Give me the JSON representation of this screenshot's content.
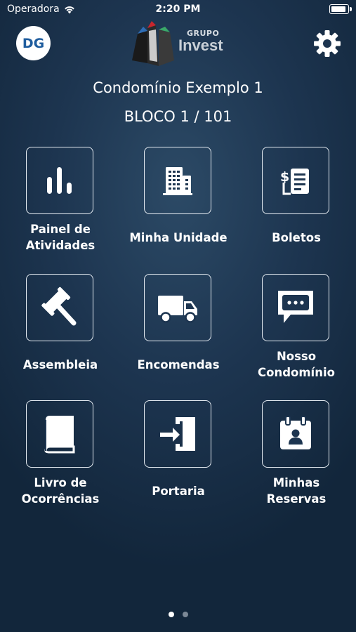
{
  "status_bar": {
    "carrier": "Operadora",
    "time": "2:20 PM"
  },
  "header": {
    "avatar_initials": "DG",
    "logo_group": "GRUPO",
    "logo_name": "Invest",
    "settings_icon": "gear-icon"
  },
  "condominium": {
    "name": "Condomínio Exemplo 1",
    "unit": "BLOCO 1 / 101"
  },
  "menu": {
    "painel": {
      "label_line1": "Painel de",
      "label_line2": "Atividades",
      "icon": "bar-chart-icon"
    },
    "unidade": {
      "label": "Minha Unidade",
      "icon": "building-icon"
    },
    "boletos": {
      "label": "Boletos",
      "icon": "invoice-icon"
    },
    "assembleia": {
      "label": "Assembleia",
      "icon": "gavel-icon"
    },
    "encomendas": {
      "label": "Encomendas",
      "icon": "truck-icon"
    },
    "nosso": {
      "label_line1": "Nosso",
      "label_line2": "Condomínio",
      "icon": "chat-bubble-icon"
    },
    "livro": {
      "label_line1": "Livro de",
      "label_line2": "Ocorrências",
      "icon": "book-icon"
    },
    "portaria": {
      "label": "Portaria",
      "icon": "door-enter-icon"
    },
    "reservas": {
      "label_line1": "Minhas",
      "label_line2": "Reservas",
      "icon": "calendar-person-icon"
    }
  },
  "pagination": {
    "current_page": 1,
    "total_pages": 2
  },
  "colors": {
    "background": "#1d3550",
    "avatar_text": "#1f5d9e",
    "logo_red": "#c8262d",
    "logo_blue": "#2f6db5",
    "logo_green": "#3aa869"
  }
}
